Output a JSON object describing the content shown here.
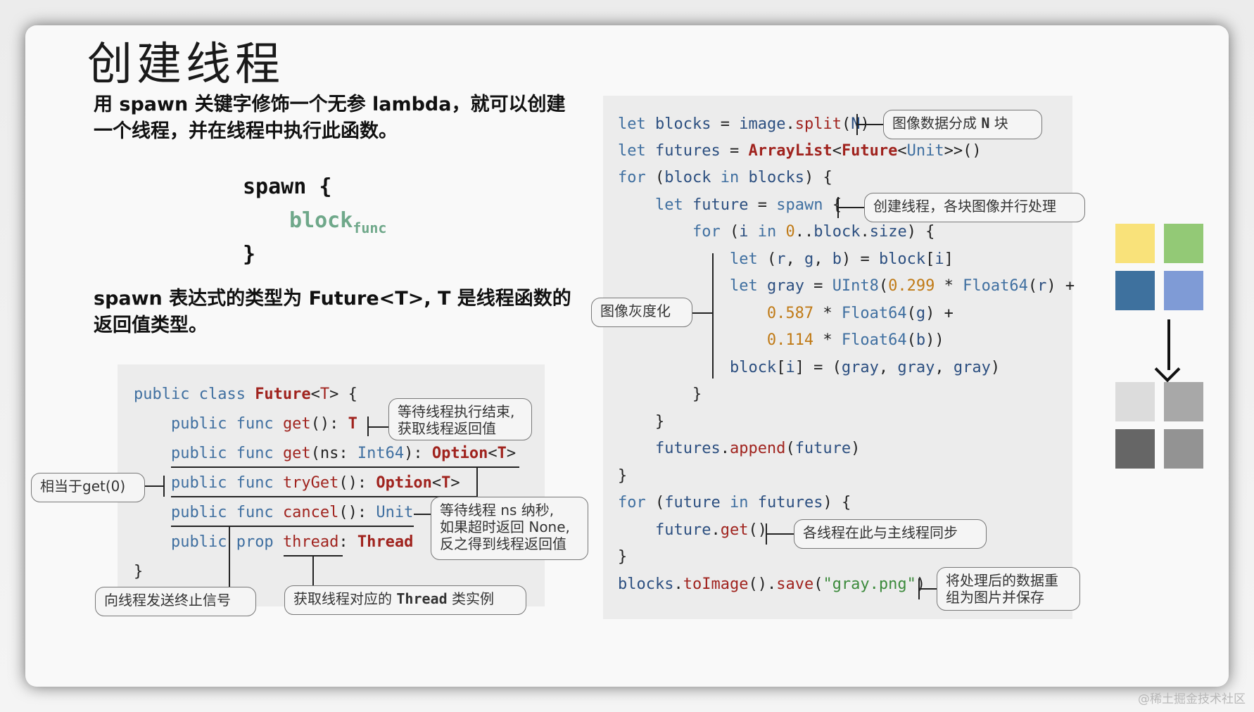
{
  "slide": {
    "title": "创建线程",
    "intro_line1": "用 spawn 关键字修饰一个无参 lambda，就可以创建",
    "intro_line2": "一个线程，并在线程中执行此函数。",
    "spawn_open": "spawn {",
    "spawn_block": "block",
    "spawn_block_sub": "func",
    "spawn_close": "}",
    "type_line1": "spawn 表达式的类型为 Future<T>, T 是线程函数的",
    "type_line2": "返回值类型。"
  },
  "future_class": {
    "lines": [
      "public class Future<T> {",
      "    public func get(): T",
      "    public func get(ns: Int64): Option<T>",
      "    public func tryGet(): Option<T>",
      "    public func cancel(): Unit",
      "    public prop thread: Thread",
      "}"
    ],
    "callouts": {
      "get_result_1": "等待线程执行结束,",
      "get_result_2": "获取线程返回值",
      "tryget": "相当于get(0)",
      "timeout_1": "等待线程 ns 纳秒,",
      "timeout_2": "如果超时返回 None,",
      "timeout_3": "反之得到线程返回值",
      "cancel": "向线程发送终止信号",
      "thread_prefix": "获取线程对应的",
      "thread_mono": "Thread",
      "thread_suffix": "类实例"
    }
  },
  "example_code": {
    "lines": [
      "let blocks = image.split(N)",
      "let futures = ArrayList<Future<Unit>>()",
      "for (block in blocks) {",
      "    let future = spawn {",
      "        for (i in 0..block.size) {",
      "            let (r, g, b) = block[i]",
      "            let gray = UInt8(0.299 * Float64(r) +",
      "                0.587 * Float64(g) +",
      "                0.114 * Float64(b))",
      "            block[i] = (gray, gray, gray)",
      "        }",
      "    }",
      "    futures.append(future)",
      "}",
      "for (future in futures) {",
      "    future.get()",
      "}",
      "blocks.toImage().save(\"gray.png\")"
    ],
    "callouts": {
      "split_1": "图像数据分成",
      "split_mono": "N",
      "split_2": "块",
      "spawn": "创建线程，各块图像并行处理",
      "gray": "图像灰度化",
      "sync": "各线程在此与主线程同步",
      "save_1": "将处理后的数据重",
      "save_2": "组为图片并保存"
    }
  },
  "color_swatches": {
    "before": [
      "#f9e27a",
      "#93c976",
      "#3e719e",
      "#7f9bd6"
    ],
    "after": [
      "#dcdcdc",
      "#a8a8a8",
      "#666666",
      "#939393"
    ]
  },
  "watermark": "@稀土掘金技术社区"
}
